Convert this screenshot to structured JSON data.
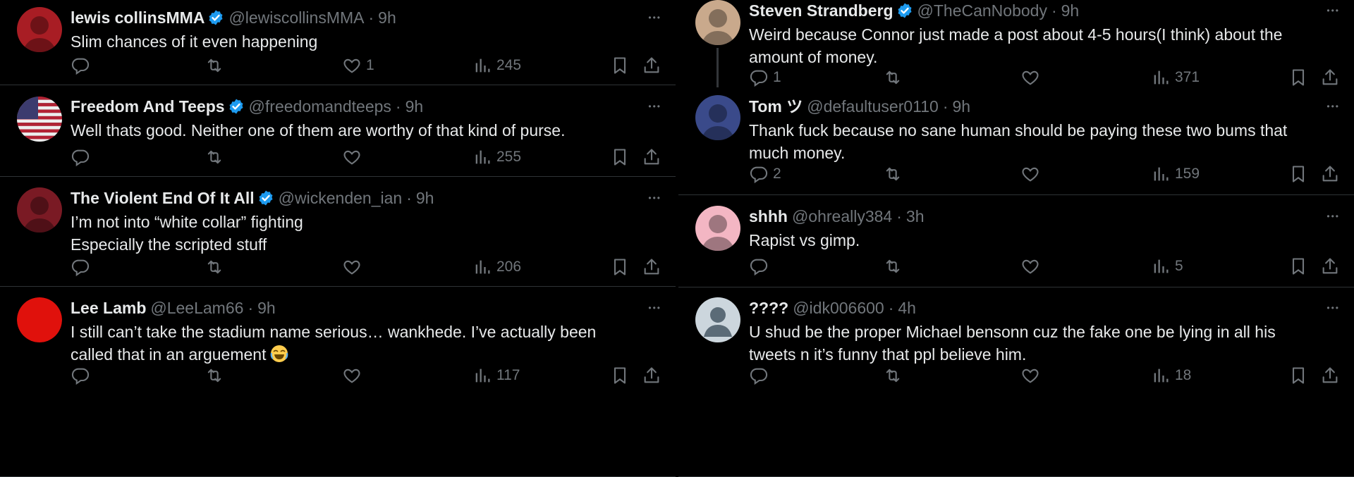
{
  "left": [
    {
      "name": "lewis collinsMMA",
      "verified": true,
      "handle": "@lewiscollinsMMA",
      "sep": "·",
      "time": "9h",
      "text_lines": [
        "Slim chances of it even happening"
      ],
      "replies": "",
      "reposts": "",
      "likes": "1",
      "views": "245",
      "avatar_color": "#a81d24"
    },
    {
      "name": "Freedom And Teeps",
      "verified": true,
      "handle": "@freedomandteeps",
      "sep": "·",
      "time": "9h",
      "text_lines": [
        "Well thats good. Neither one of them are worthy of that kind of purse."
      ],
      "replies": "",
      "reposts": "",
      "likes": "",
      "views": "255",
      "avatar_color": "#b22234"
    },
    {
      "name": "The Violent End Of It All",
      "verified": true,
      "handle": "@wickenden_ian",
      "sep": "·",
      "time": "9h",
      "text_lines": [
        "I’m not into “white collar” fighting",
        "Especially the scripted stuff"
      ],
      "replies": "",
      "reposts": "",
      "likes": "",
      "views": "206",
      "avatar_color": "#7a1a24"
    },
    {
      "name": "Lee Lamb",
      "verified": false,
      "handle": "@LeeLam66",
      "sep": "·",
      "time": "9h",
      "text_lines": [
        "I still can’t take the stadium name serious… wankhede. I’ve actually been",
        "called that in an arguement"
      ],
      "emoji_after": "joy-emoji",
      "replies": "",
      "reposts": "",
      "likes": "",
      "views": "117",
      "avatar_color": "#e0110c"
    }
  ],
  "right": [
    {
      "name": "Steven Strandberg",
      "verified": true,
      "handle": "@TheCanNobody",
      "sep": "·",
      "time": "9h",
      "text_lines": [
        "Weird because Connor just made a post about 4-5 hours(I think) about the",
        "amount of money."
      ],
      "replies": "1",
      "reposts": "",
      "likes": "",
      "views": "371",
      "avatar_color": "#c9a98c"
    },
    {
      "name": "Tom ツ",
      "verified": false,
      "handle": "@defaultuser0110",
      "sep": "·",
      "time": "9h",
      "text_lines": [
        "Thank fuck because no sane human should be paying these two bums that",
        "much money."
      ],
      "replies": "2",
      "reposts": "",
      "likes": "",
      "views": "159",
      "avatar_color": "#3a4a8a"
    },
    {
      "name": "shhh",
      "verified": false,
      "handle": "@ohreally384",
      "sep": "·",
      "time": "3h",
      "text_lines": [
        "Rapist vs gimp."
      ],
      "replies": "",
      "reposts": "",
      "likes": "",
      "views": "5",
      "avatar_color": "#f3b6c3"
    },
    {
      "name": "????",
      "verified": false,
      "handle": "@idk006600",
      "sep": "·",
      "time": "4h",
      "text_lines": [
        "U shud be the proper Michael bensonn cuz the fake one be lying in all his",
        "tweets n it’s funny that ppl believe him."
      ],
      "replies": "",
      "reposts": "",
      "likes": "",
      "views": "18",
      "avatar_color": "#ccd6dd"
    }
  ],
  "colors": {
    "background": "#000000",
    "text": "#e7e9ea",
    "muted": "#71767b",
    "verified": "#1d9bf0",
    "divider": "#2f3336"
  },
  "icons": [
    "reply-icon",
    "repost-icon",
    "like-icon",
    "views-icon",
    "bookmark-icon",
    "share-icon",
    "more-icon",
    "verified-badge-icon"
  ]
}
